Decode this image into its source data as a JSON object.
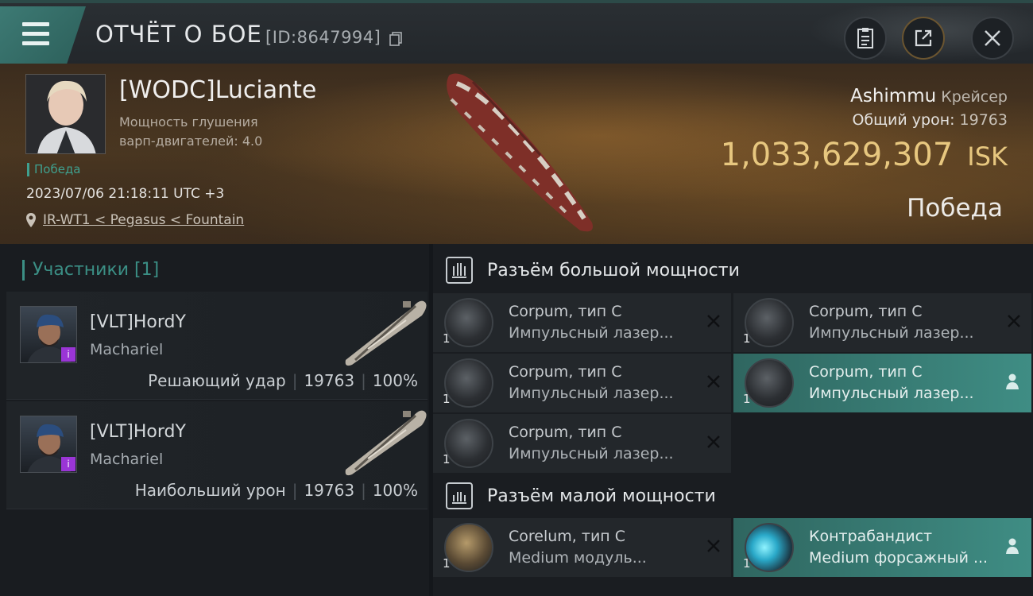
{
  "header": {
    "title": "ОТЧЁТ О БОЕ",
    "report_id": "[ID:8647994]"
  },
  "victim": {
    "pilot_name": "[WODC]Luciante",
    "warp_label_line1": "Мощность глушения",
    "warp_label_line2": "варп-двигателей: 4.0",
    "status_tag": "Победа",
    "datetime": "2023/07/06 21:18:11 UTC +3",
    "location": "IR-WT1 < Pegasus < Fountain",
    "ship_name": "Ashimmu",
    "ship_class": "Крейсер",
    "total_damage_label": "Общий урон:",
    "total_damage": "19763",
    "isk_value": "1,033,629,307",
    "isk_unit": "ISK",
    "result": "Победа"
  },
  "participants": {
    "title": "Участники [1]",
    "items": [
      {
        "name": "[VLT]HordY",
        "ship": "Machariel",
        "role": "Решающий удар",
        "damage": "19763",
        "percent": "100%",
        "badge": "i"
      },
      {
        "name": "[VLT]HordY",
        "ship": "Machariel",
        "role": "Наибольший урон",
        "damage": "19763",
        "percent": "100%",
        "badge": "i"
      }
    ]
  },
  "fitting": {
    "high_slots_title": "Разъём большой мощности",
    "low_slots_title": "Разъём малой мощности",
    "high": [
      {
        "qty": "1",
        "name": "Corpum, тип C",
        "type": "Импульсный лазер..."
      },
      {
        "qty": "1",
        "name": "Corpum, тип C",
        "type": "Импульсный лазер..."
      },
      {
        "qty": "1",
        "name": "Corpum, тип C",
        "type": "Импульсный лазер..."
      },
      {
        "qty": "1",
        "name": "Corpum, тип C",
        "type": "Импульсный лазер..."
      },
      {
        "qty": "1",
        "name": "Corpum, тип C",
        "type": "Импульсный лазер..."
      }
    ],
    "low": [
      {
        "qty": "1",
        "name": "Corelum, тип C",
        "type": "Medium модуль..."
      },
      {
        "qty": "1",
        "name": "Контрабандист",
        "type": "Medium форсажный ..."
      }
    ]
  },
  "colors": {
    "accent_teal": "#3f8d84",
    "victory_green": "#3fa08f",
    "isk_gold": "#e7c77f",
    "badge_purple": "#9a35d6"
  }
}
